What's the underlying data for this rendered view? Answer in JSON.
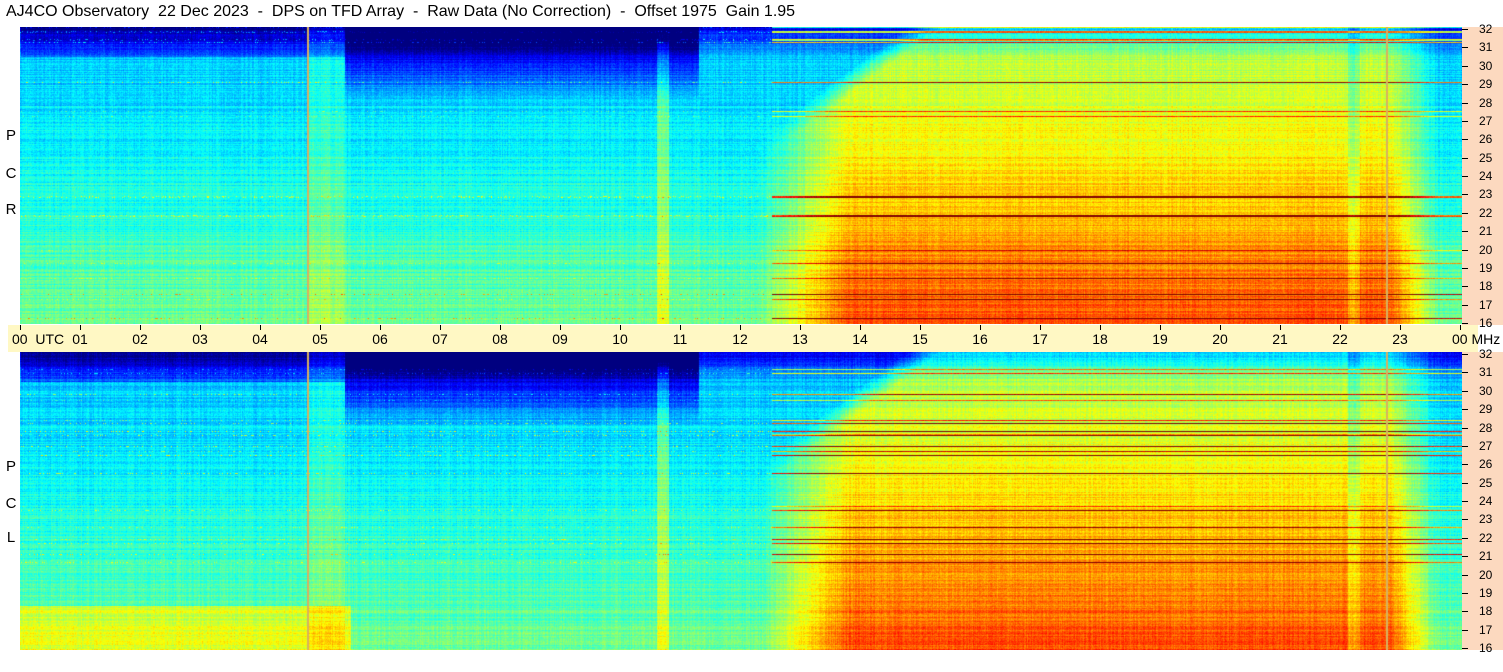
{
  "title": "AJ4CO Observatory  22 Dec 2023  -  DPS on TFD Array  -  Raw Data (No Correction)  -  Offset 1975  Gain 1.95",
  "panels": [
    {
      "label_letters": [
        "R",
        "C",
        "P"
      ]
    },
    {
      "label_letters": [
        "L",
        "C",
        "P"
      ]
    }
  ],
  "time_axis": {
    "labels": [
      "00  UTC",
      "01",
      "02",
      "03",
      "04",
      "05",
      "06",
      "07",
      "08",
      "09",
      "10",
      "11",
      "12",
      "13",
      "14",
      "15",
      "16",
      "17",
      "18",
      "19",
      "20",
      "21",
      "22",
      "23",
      "00 MHz"
    ]
  },
  "freq_axis": {
    "unit": "MHz",
    "labels": [
      "32",
      "31",
      "30",
      "29",
      "28",
      "27",
      "26",
      "25",
      "24",
      "23",
      "22",
      "21",
      "20",
      "19",
      "18",
      "17",
      "16"
    ]
  },
  "colors": {
    "time_axis_bg": "#fff8c4",
    "freq_axis_bg": "#fcd9bf",
    "marker_line": "#d8b060"
  },
  "colormap": "jet (dark blue low to red high)"
}
